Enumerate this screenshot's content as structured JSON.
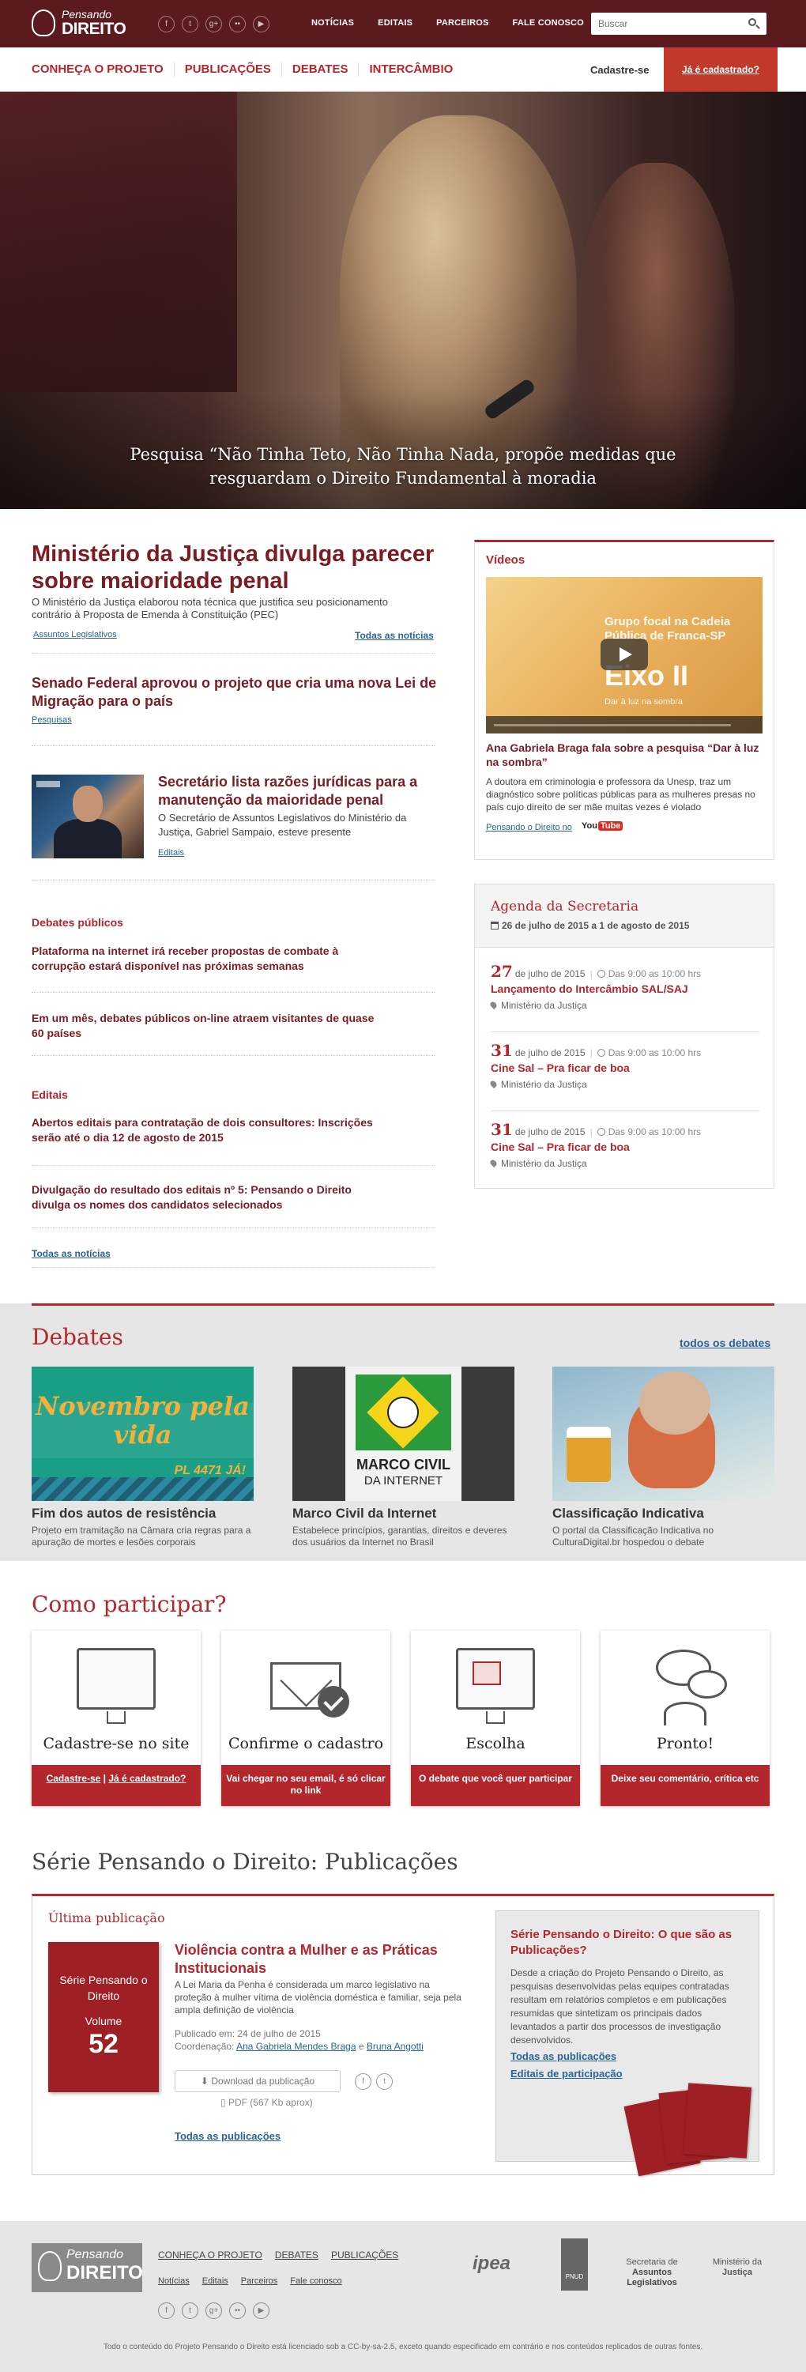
{
  "header": {
    "logo_line1": "Pensando",
    "logo_line2": "DIREITO",
    "social_icons": [
      "facebook-icon",
      "twitter-icon",
      "google-plus-icon",
      "flickr-icon",
      "youtube-icon"
    ],
    "social_glyphs": [
      "f",
      "t",
      "g+",
      "••",
      "▶"
    ],
    "top_nav": [
      "NOTÍCIAS",
      "EDITAIS",
      "PARCEIROS",
      "FALE CONOSCO"
    ],
    "search_placeholder": "Buscar"
  },
  "main_nav": {
    "items": [
      "CONHEÇA O PROJETO",
      "PUBLICAÇÕES",
      "DEBATES",
      "INTERCÂMBIO"
    ],
    "register": "Cadastre-se",
    "already_registered": "Já é cadastrado?"
  },
  "hero": {
    "caption": "Pesquisa “Não Tinha Teto, Não Tinha Nada, propõe medidas que resguardam o Direito Fundamental à moradia"
  },
  "news": {
    "lead": {
      "title": "Ministério da Justiça divulga parecer sobre maioridade penal",
      "desc": "O Ministério da Justiça elaborou nota técnica que justifica seu posicionamento contrário à Proposta de Emenda à Constituição (PEC)",
      "tag": "Assuntos Legislativos"
    },
    "all_news_top": "Todas as notícias",
    "story2": {
      "title": "Senado Federal aprovou  o projeto que cria uma nova Lei de Migração para o país",
      "tag": "Pesquisas"
    },
    "story3": {
      "title": "Secretário lista razões jurídicas para a manutenção da maioridade penal",
      "desc": "O Secretário de Assuntos Legislativos do Ministério da Justiça, Gabriel Sampaio, esteve presente",
      "tag": "Editais"
    },
    "debates_label": "Debates públicos",
    "debates_items": [
      "Plataforma na internet irá receber propostas de combate à corrupção estará disponível nas próximas semanas",
      "Em um mês, debates públicos on-line atraem visitantes de quase 60 países"
    ],
    "editais_label": "Editais",
    "editais_items": [
      "Abertos editais para contratação de dois consultores: Inscrições serão até o dia 12 de agosto de 2015",
      "Divulgação do resultado dos editais nº 5: Pensando o Direito divulga os nomes dos candidatos selecionados"
    ],
    "all_news_bottom": "Todas as notícias"
  },
  "videos": {
    "title": "Vídeos",
    "thumb_line1": "Grupo focal na Cadeia Pública de Franca-SP",
    "thumb_line2": "Eixo II",
    "thumb_line3": "Dar à luz na sombra",
    "video_title": "Ana Gabriela Braga fala sobre a pesquisa “Dar à luz na sombra”",
    "video_desc": "A doutora em criminologia e professora da Unesp, traz um diagnóstico sobre políticas públicas para as  mulheres presas no país cujo direito de ser mãe muitas vezes é violado",
    "source_link": "Pensando o Direito no",
    "yt_you": "You",
    "yt_tube": "Tube"
  },
  "agenda": {
    "title": "Agenda da Secretaria",
    "range": "26 de julho de 2015 a 1 de agosto de 2015",
    "events": [
      {
        "day": "27",
        "month": "de julho de 2015",
        "time": "Das 9:00 as 10:00 hrs",
        "title": "Lançamento do Intercâmbio SAL/SAJ",
        "place": "Ministério da Justiça"
      },
      {
        "day": "31",
        "month": "de julho de 2015",
        "time": "Das 9:00 as 10:00 hrs",
        "title": "Cine Sal – Pra ficar de boa",
        "place": "Ministério da Justiça"
      },
      {
        "day": "31",
        "month": "de julho de 2015",
        "time": "Das 9:00 as 10:00 hrs",
        "title": "Cine Sal – Pra ficar de boa",
        "place": "Ministério da Justiça"
      }
    ]
  },
  "debates": {
    "title": "Debates",
    "all_link": "todos os debates",
    "cards": [
      {
        "title": "Fim dos autos de resistência",
        "desc": "Projeto em tramitação na Câmara cria regras para a apuração de mortes e lesões corporais",
        "img_text1": "Novembro pela vida",
        "img_text2": "PL 4471 JÁ!"
      },
      {
        "title": "Marco Civil da Internet",
        "desc": "Estabelece princípios, garantias, direitos e deveres dos usuários da Internet no Brasil",
        "img_text1": "MARCO CIVIL",
        "img_text2": "DA INTERNET"
      },
      {
        "title": "Classificação Indicativa",
        "desc": "O portal da Classificação Indicativa no CulturaDigital.br hospedou o debate"
      }
    ]
  },
  "participar": {
    "title": "Como participar?",
    "cards": [
      {
        "caption": "Cadastre-se no site",
        "foot_link1": "Cadastre-se",
        "foot_sep": "|",
        "foot_link2": "Já é cadastrado?"
      },
      {
        "caption": "Confirme o cadastro",
        "foot": "Vai chegar no seu email, é só clicar no link"
      },
      {
        "caption": "Escolha",
        "foot": "O debate que você quer participar"
      },
      {
        "caption": "Pronto!",
        "foot": "Deixe seu comentário, crítica etc"
      }
    ]
  },
  "publicacoes": {
    "title": "Série Pensando o Direito: Publicações",
    "latest_label": "Última publicação",
    "cover_line1": "Série Pensando o Direito",
    "cover_line2": "Volume",
    "cover_number": "52",
    "pub_title": "Violência contra a Mulher e as Práticas Institucionais",
    "pub_desc": "A Lei Maria da Penha é considerada um marco legislativo na proteção à mulher vítima de violência doméstica e familiar, seja pela ampla definição de violência",
    "published": "Publicado em: 24 de julho de 2015",
    "coord_label": "Coordenação:",
    "coord1": "Ana Gabriela Mendes Braga",
    "coord_and": "e",
    "coord2": "Bruna Angotti",
    "download": "Download da publicação",
    "pdf": "PDF (567 Kb aprox)",
    "all_link": "Todas as publicações",
    "serie_title": "Série Pensando o Direito: O que são as Publicações?",
    "serie_desc": "Desde a criação do Projeto Pensando o Direito, as pesquisas desenvolvidas pelas equipes contratadas resultam em relatórios completos e em publicações resumidas que sintetizam os principais dados levantados a partir dos processos de investigação desenvolvidos.",
    "serie_link1": "Todas as publicações",
    "serie_link2": "Editais de participação"
  },
  "footer": {
    "logo_line1": "Pensando",
    "logo_line2": "DIREITO",
    "nav1": [
      "CONHEÇA O PROJETO",
      "DEBATES",
      "PUBLICAÇÕES"
    ],
    "nav2": [
      "Notícias",
      "Editais",
      "Parceiros",
      "Fale conosco"
    ],
    "partner_ipea": "ipea",
    "partner_pnud": "PNUD",
    "partner_sal1": "Secretaria de",
    "partner_sal2": "Assuntos Legislativos",
    "partner_mj1": "Ministério da",
    "partner_mj2": "Justiça",
    "license": "Todo o conteúdo do Projeto Pensando o Direito está licenciado sob a CC-by-sa-2.5, exceto quando especificado em contrário e nos conteúdos replicados de outras fontes."
  },
  "colors": {
    "topbar": "#5a1a1e",
    "accent": "#b3262c",
    "headline": "#7b1c22",
    "link": "#2a6496"
  }
}
